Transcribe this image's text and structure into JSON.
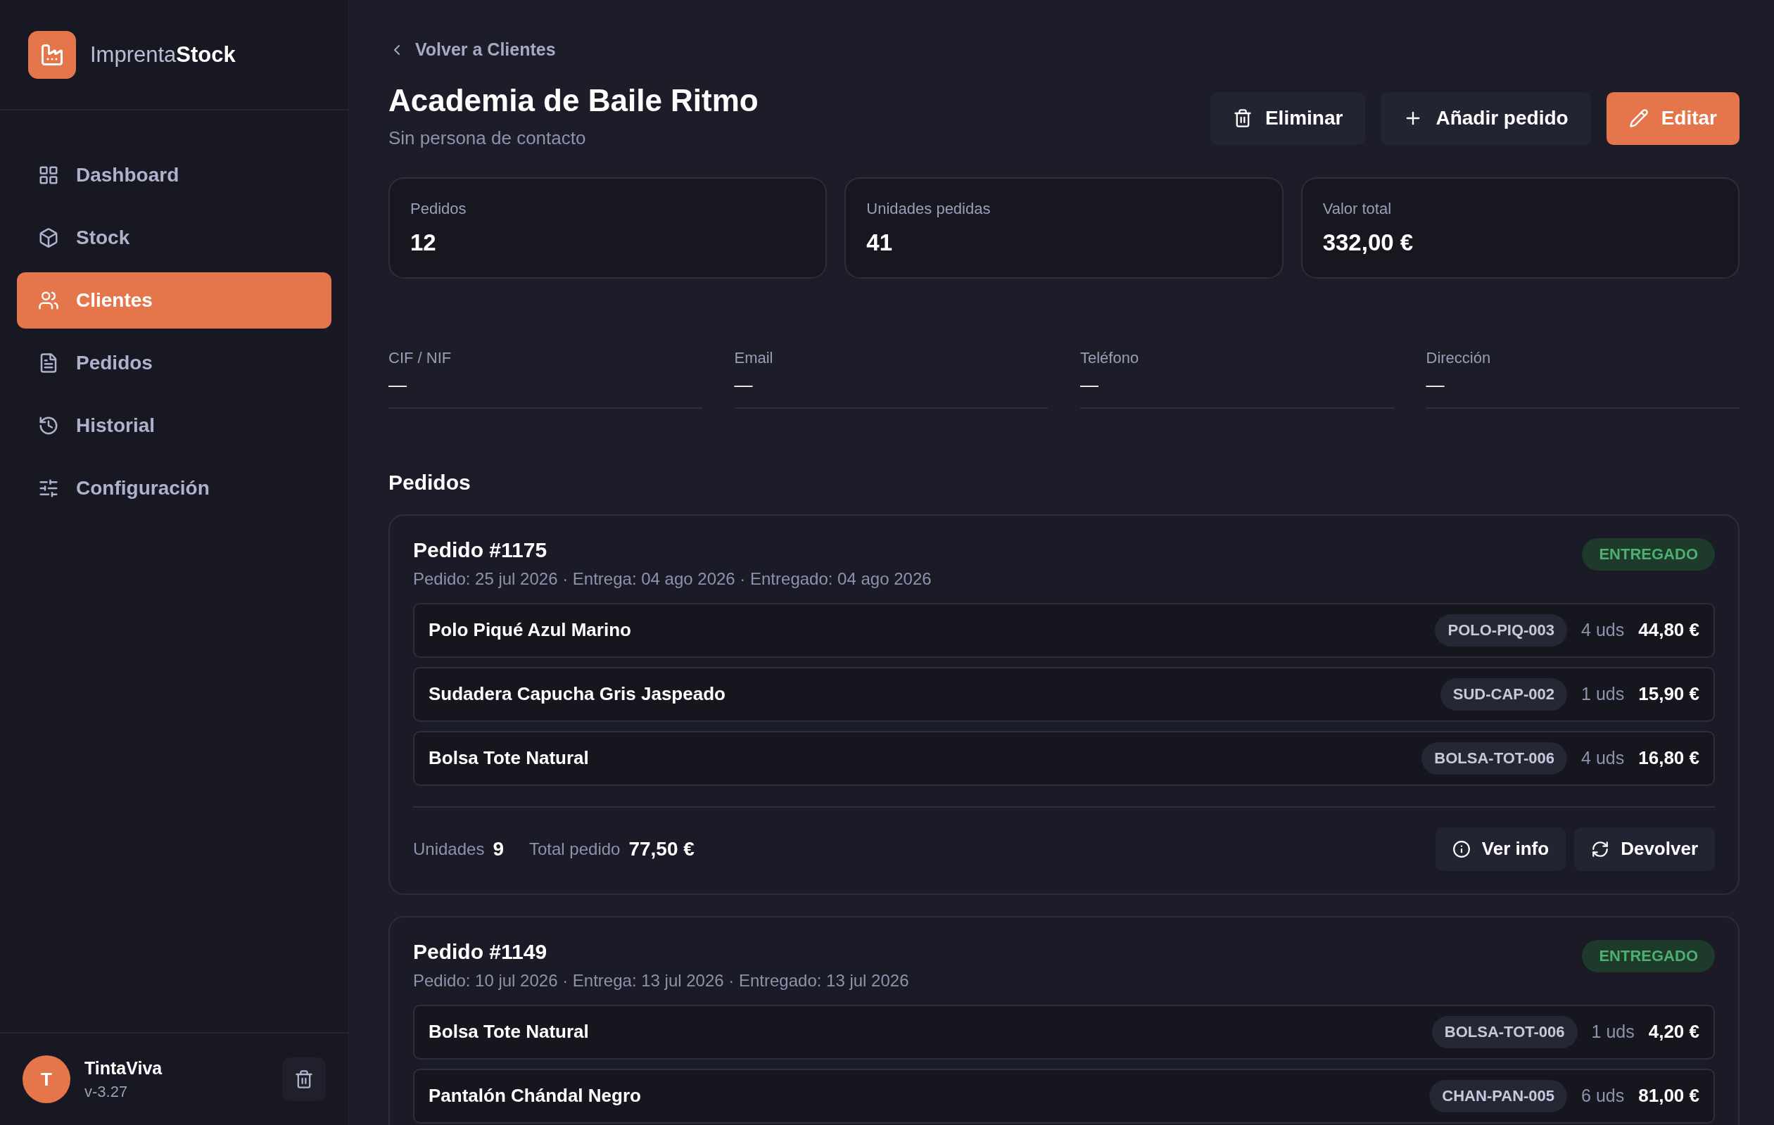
{
  "brand": {
    "name": "Imprenta**Stock**"
  },
  "sidebar": {
    "items": [
      {
        "label": "Dashboard",
        "selected": false
      },
      {
        "label": "Stock",
        "selected": false
      },
      {
        "label": "Clientes",
        "selected": true
      },
      {
        "label": "Pedidos",
        "selected": false
      },
      {
        "label": "Historial",
        "selected": false
      },
      {
        "label": "Configuración",
        "selected": false
      }
    ],
    "user": {
      "initial": "T",
      "name": "TintaViva",
      "version": "v-3.27"
    }
  },
  "back_link": "Volver a Clientes",
  "client": {
    "name": "Academia de Baile Ritmo",
    "contact": "Sin persona de contacto"
  },
  "actions": [
    {
      "label": "Eliminar",
      "kind": "secondary"
    },
    {
      "label": "Añadir pedido",
      "kind": "secondary"
    },
    {
      "label": "Editar",
      "kind": "primary"
    }
  ],
  "stats": [
    {
      "label": "Pedidos",
      "value": "12"
    },
    {
      "label": "Unidades pedidas",
      "value": "41"
    },
    {
      "label": "Valor total",
      "value": "332,00 €"
    }
  ],
  "fields": [
    {
      "label": "CIF / NIF",
      "value": "—"
    },
    {
      "label": "Email",
      "value": "—"
    },
    {
      "label": "Teléfono",
      "value": "—"
    },
    {
      "label": "Dirección",
      "value": "—"
    }
  ],
  "orders_heading": "Pedidos",
  "orders": [
    {
      "title": "Pedido #1175",
      "meta": "Pedido: 25 jul 2026 · Entrega: 04 ago 2026 · Entregado: 04 ago 2026",
      "status": {
        "label": "ENTREGADO",
        "kind": "delivered"
      },
      "items": [
        {
          "name": "Polo Piqué Azul Marino",
          "sku": "POLO-PIQ-003",
          "qty": "4 uds",
          "price": "44,80 €"
        },
        {
          "name": "Sudadera Capucha Gris Jaspeado",
          "sku": "SUD-CAP-002",
          "qty": "1 uds",
          "price": "15,90 €"
        },
        {
          "name": "Bolsa Tote Natural",
          "sku": "BOLSA-TOT-006",
          "qty": "4 uds",
          "price": "16,80 €"
        }
      ],
      "footer": {
        "units_label": "Unidades",
        "units": "9",
        "total_label": "Total pedido",
        "total": "77,50 €",
        "buttons": [
          "Ver info",
          "Devolver"
        ]
      }
    },
    {
      "title": "Pedido #1149",
      "meta": "Pedido: 10 jul 2026 · Entrega: 13 jul 2026 · Entregado: 13 jul 2026",
      "status": {
        "label": "ENTREGADO",
        "kind": "delivered"
      },
      "items": [
        {
          "name": "Bolsa Tote Natural",
          "sku": "BOLSA-TOT-006",
          "qty": "1 uds",
          "price": "4,20 €"
        },
        {
          "name": "Pantalón Chándal Negro",
          "sku": "CHAN-PAN-005",
          "qty": "6 uds",
          "price": "81,00 €"
        }
      ]
    }
  ]
}
